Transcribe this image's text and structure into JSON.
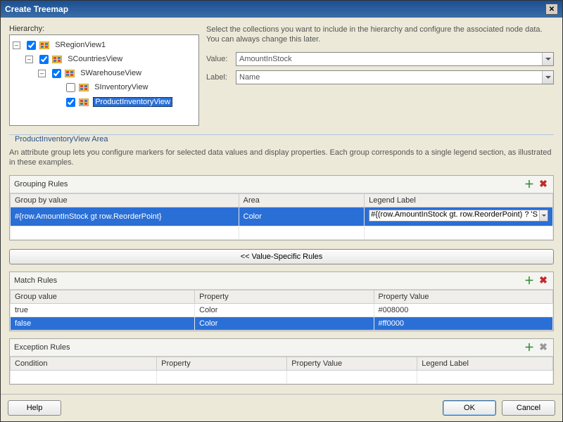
{
  "title": "Create Treemap",
  "hierarchy_label": "Hierarchy:",
  "tree": {
    "n0": {
      "label": "SRegionView1",
      "checked": true
    },
    "n1": {
      "label": "SCountriesView",
      "checked": true
    },
    "n2": {
      "label": "SWarehouseView",
      "checked": true
    },
    "n3": {
      "label": "SInventoryView",
      "checked": false
    },
    "n4": {
      "label": "ProductInventoryView",
      "checked": true,
      "selected": true
    }
  },
  "right": {
    "desc": "Select the collections you want to include in the hierarchy and configure the associated node data. You can always change this later.",
    "value_label": "Value:",
    "label_label": "Label:",
    "value_selected": "AmountInStock",
    "label_selected": "Name"
  },
  "area_section_legend": "ProductInventoryView Area",
  "area_section_desc": "An attribute group lets you configure markers for selected data values and display properties. Each group corresponds to a single legend section, as illustrated in these examples.",
  "grouping": {
    "title": "Grouping Rules",
    "cols": {
      "c0": "Group by value",
      "c1": "Area",
      "c2": "Legend Label"
    },
    "row0": {
      "group_by": "#{row.AmountInStock gt row.ReorderPoint}",
      "area": "Color",
      "legend": "#{(row.AmountInStock gt. row.ReorderPoint) ? 'S"
    }
  },
  "value_specific_btn": "<< Value-Specific Rules",
  "match": {
    "title": "Match Rules",
    "cols": {
      "c0": "Group value",
      "c1": "Property",
      "c2": "Property Value"
    },
    "row0": {
      "val": "true",
      "prop": "Color",
      "pval": "#008000"
    },
    "row1": {
      "val": "false",
      "prop": "Color",
      "pval": "#ff0000"
    }
  },
  "exception": {
    "title": "Exception Rules",
    "cols": {
      "c0": "Condition",
      "c1": "Property",
      "c2": "Property Value",
      "c3": "Legend Label"
    }
  },
  "buttons": {
    "help": "Help",
    "ok": "OK",
    "cancel": "Cancel"
  }
}
